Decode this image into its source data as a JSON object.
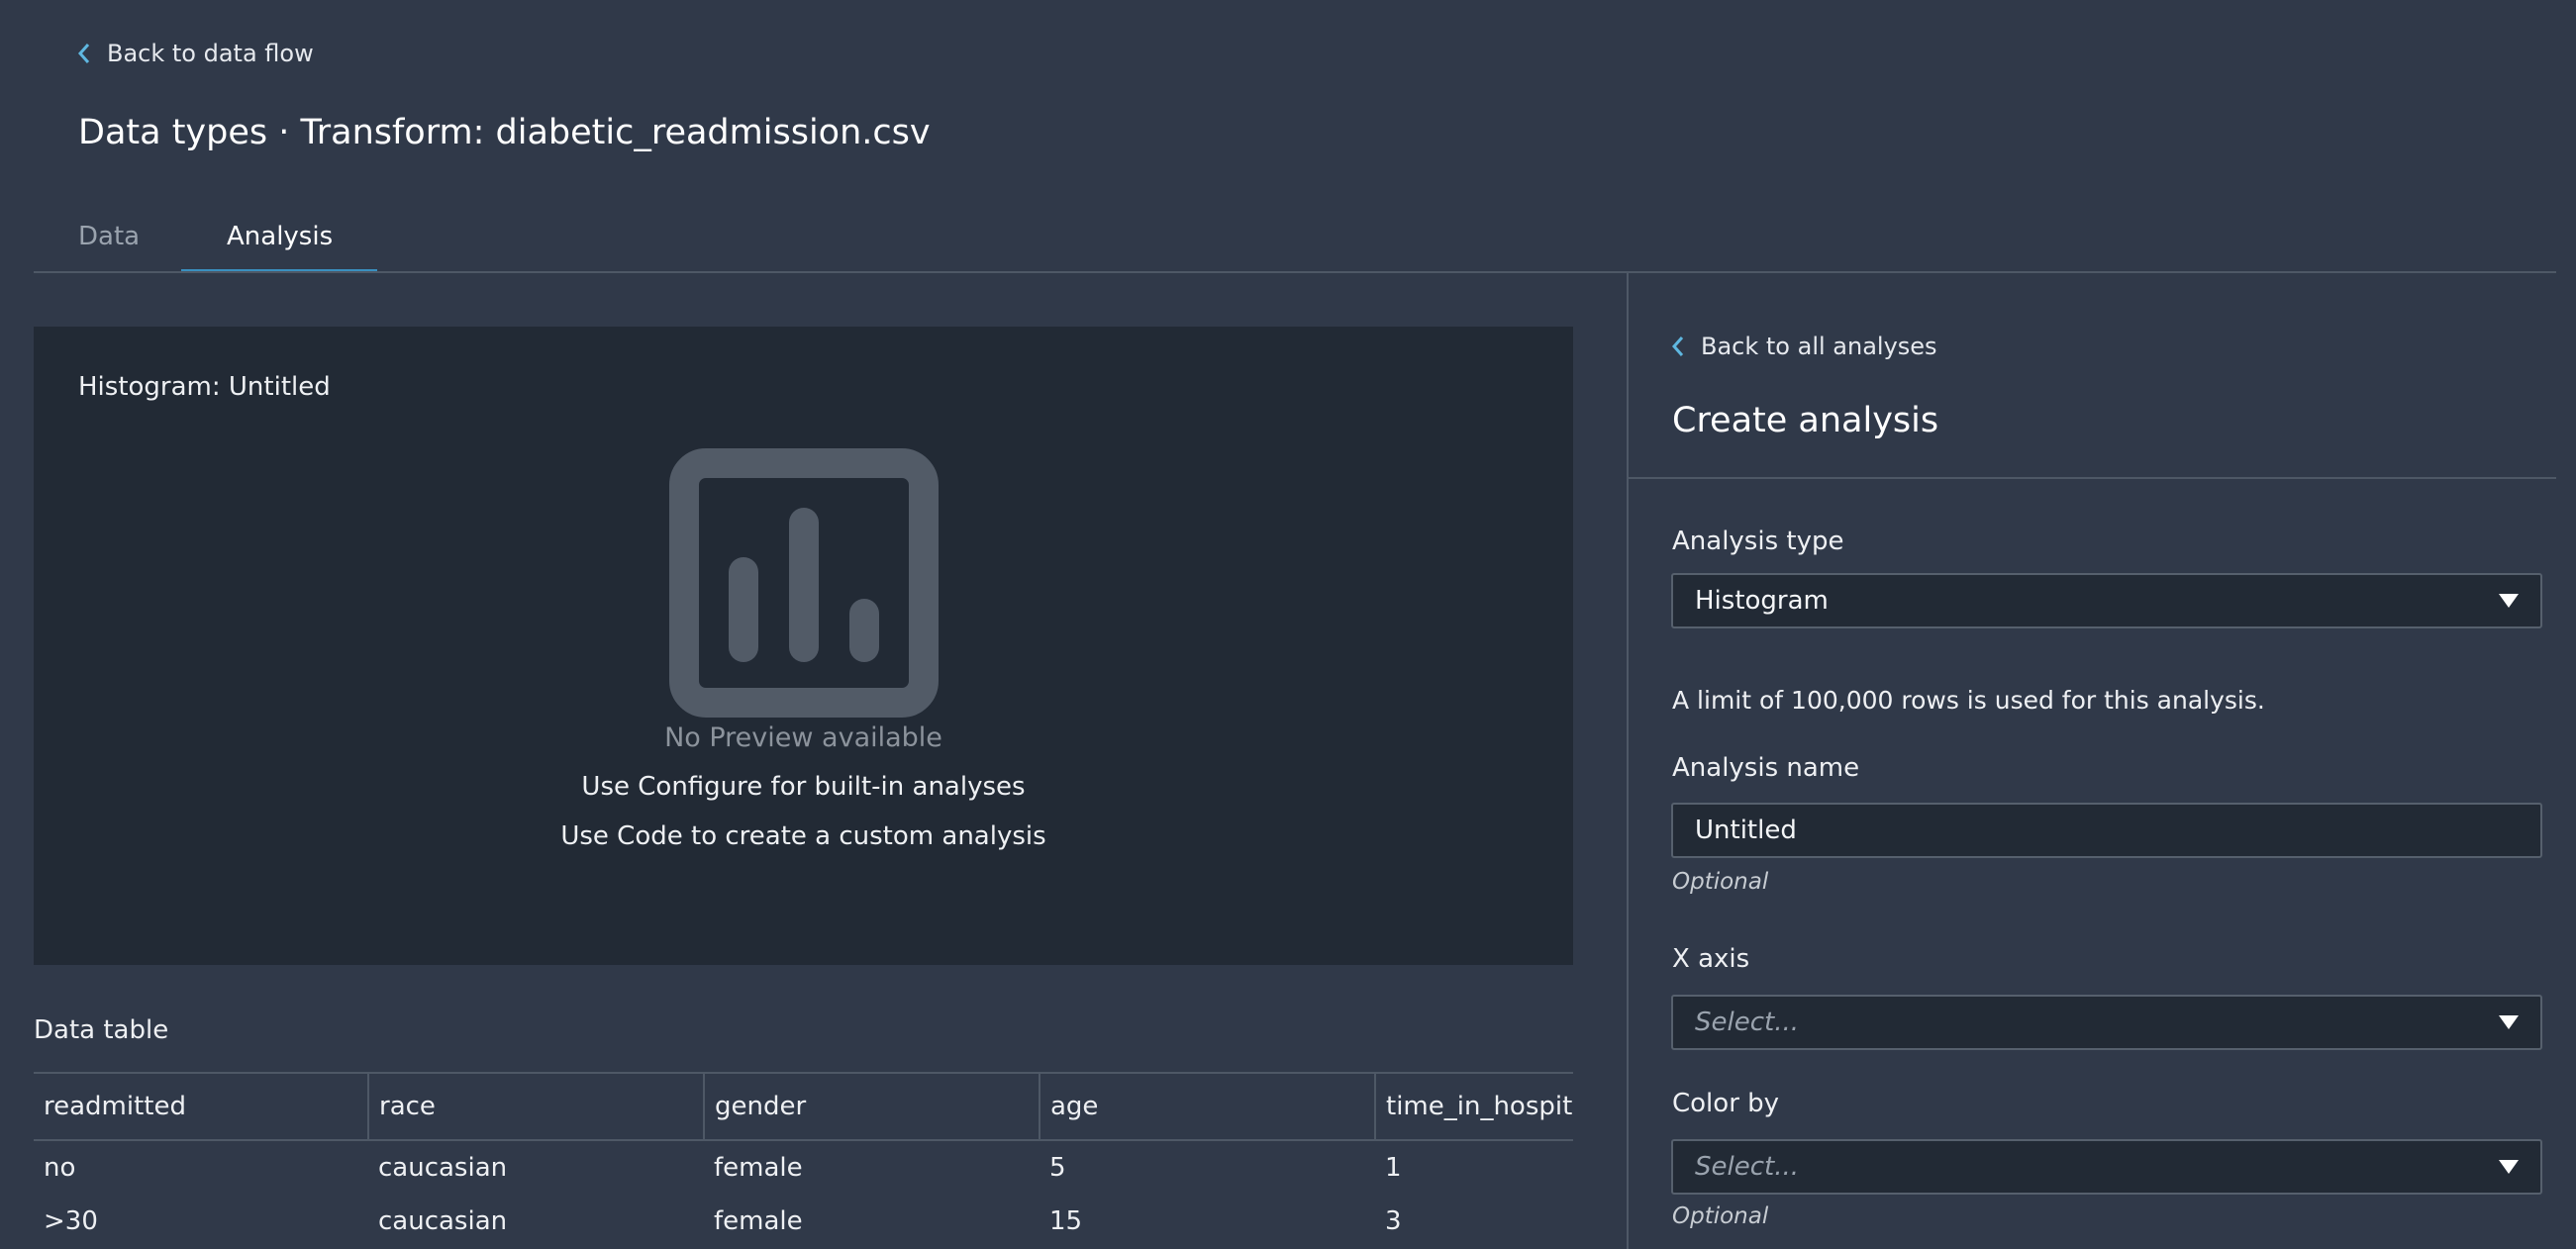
{
  "header": {
    "back_label": "Back to data flow",
    "title": "Data types · Transform: diabetic_readmission.csv"
  },
  "tabs": [
    {
      "label": "Data",
      "active": false
    },
    {
      "label": "Analysis",
      "active": true
    }
  ],
  "preview": {
    "title": "Histogram: Untitled",
    "icon": "bar-chart-icon",
    "no_preview": "No Preview available",
    "hint1": "Use Configure for built-in analyses",
    "hint2": "Use Code to create a custom analysis"
  },
  "data_table": {
    "label": "Data table",
    "columns": [
      "readmitted",
      "race",
      "gender",
      "age",
      "time_in_hospita"
    ],
    "rows": [
      [
        "no",
        "caucasian",
        "female",
        "5",
        "1"
      ],
      [
        ">30",
        "caucasian",
        "female",
        "15",
        "3"
      ]
    ]
  },
  "panel": {
    "back_label": "Back to all analyses",
    "title": "Create analysis",
    "analysis_type_label": "Analysis type",
    "analysis_type_value": "Histogram",
    "limit_info": "A limit of 100,000 rows is used for this analysis.",
    "analysis_name_label": "Analysis name",
    "analysis_name_value": "Untitled",
    "optional": "Optional",
    "x_axis_label": "X axis",
    "select_placeholder": "Select...",
    "color_by_label": "Color by"
  },
  "colors": {
    "background": "#303949",
    "panel": "#222a35",
    "accent": "#3a8fbf"
  }
}
